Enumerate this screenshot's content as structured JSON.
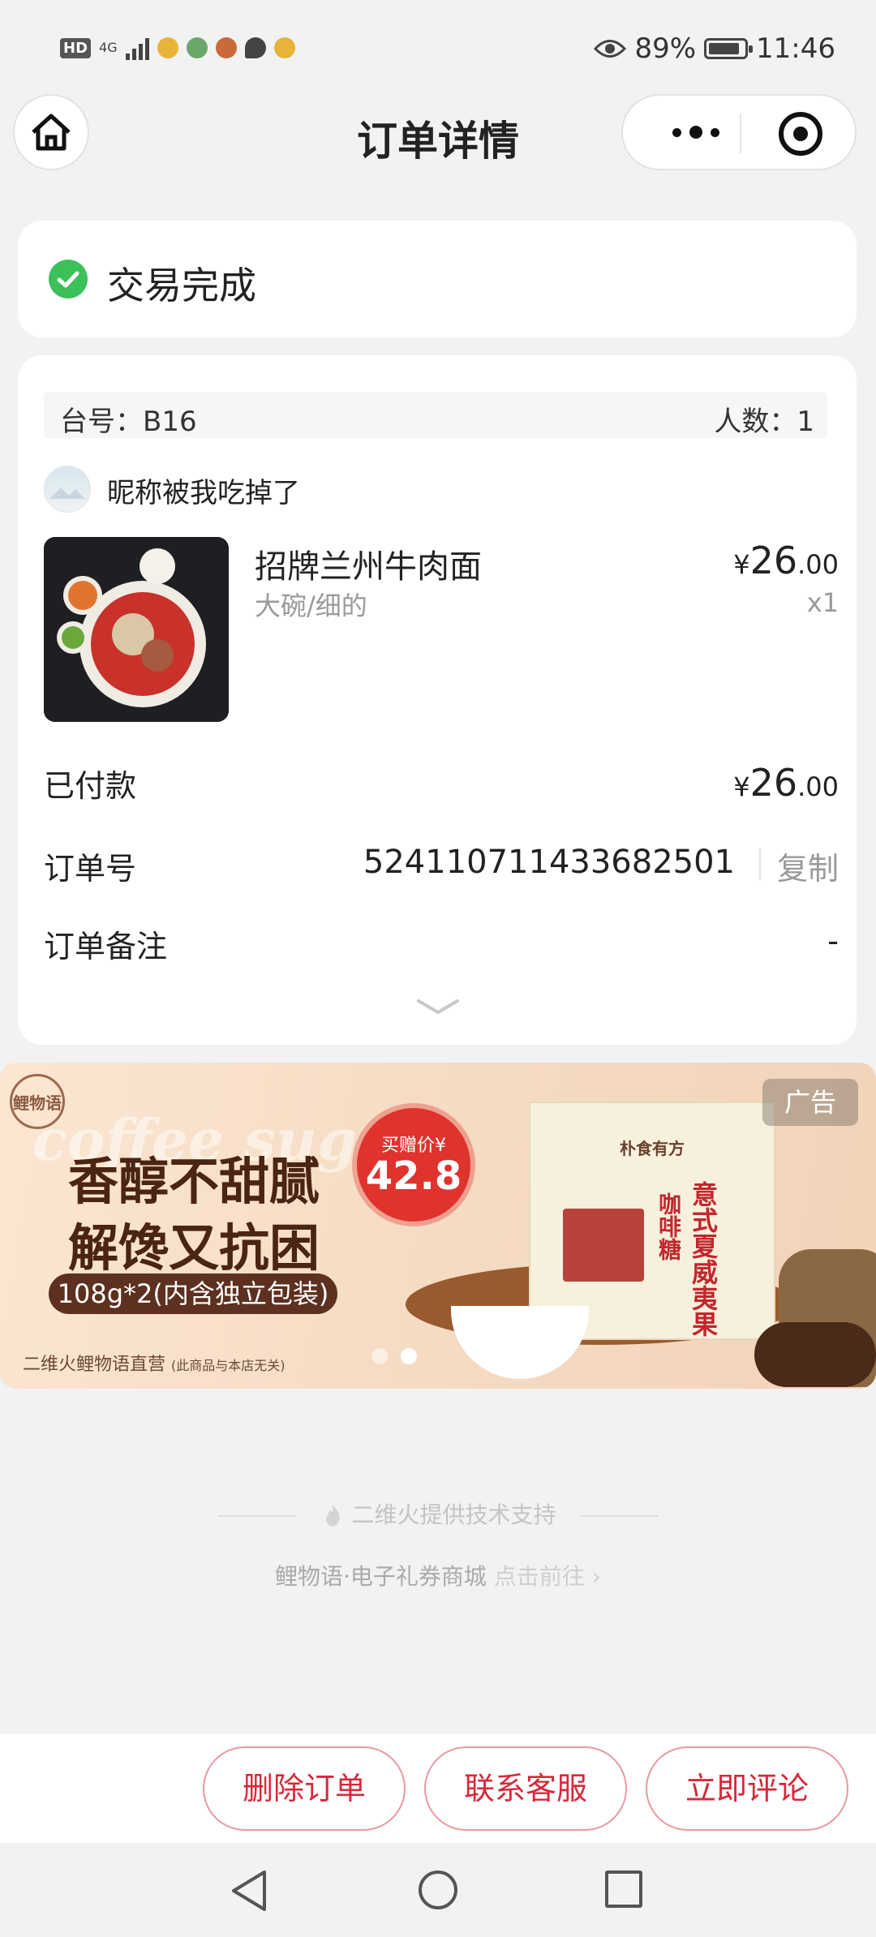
{
  "status_bar": {
    "hd": "HD",
    "network": "4G",
    "battery_percent": "89%",
    "battery_level": 0.89,
    "time": "11:46"
  },
  "nav": {
    "title": "订单详情"
  },
  "order_status": {
    "text": "交易完成"
  },
  "order": {
    "table_label": "台号：B16",
    "people_label": "人数：1",
    "user_name": "昵称被我吃掉了",
    "item": {
      "name": "招牌兰州牛肉面",
      "spec": "大碗/细的",
      "price_currency": "¥",
      "price_int": "26",
      "price_dec": ".00",
      "qty": "x1"
    },
    "paid_label": "已付款",
    "paid_currency": "¥",
    "paid_int": "26",
    "paid_dec": ".00",
    "order_no_label": "订单号",
    "order_no": "524110711433682501",
    "copy_label": "复制",
    "remark_label": "订单备注",
    "remark_value": "-"
  },
  "ad": {
    "logo_text": "鲤物语",
    "script_text": "coffee sugar",
    "headline1": "香醇不甜腻",
    "headline2": "解馋又抗困",
    "spec_pill": "108g*2(内含独立包装)",
    "footer_text": "二维火鲤物语直营",
    "footer_note": "(此商品与本店无关)",
    "badge_text": "买赠价¥",
    "badge_price": "42.8",
    "tag": "广告",
    "box_brand": "朴食有方",
    "box_text1": "咖啡糖",
    "box_text2": "意式夏威夷果"
  },
  "footer": {
    "powered_by": "二维火提供技术支持",
    "mall_text": "鲤物语·电子礼券商城",
    "mall_link": "点击前往 ›"
  },
  "actions": {
    "delete": "删除订单",
    "contact": "联系客服",
    "review": "立即评论"
  },
  "colors": {
    "accent_red": "#d8283a",
    "success_green": "#3bc05a",
    "background": "#f2f2f2"
  }
}
